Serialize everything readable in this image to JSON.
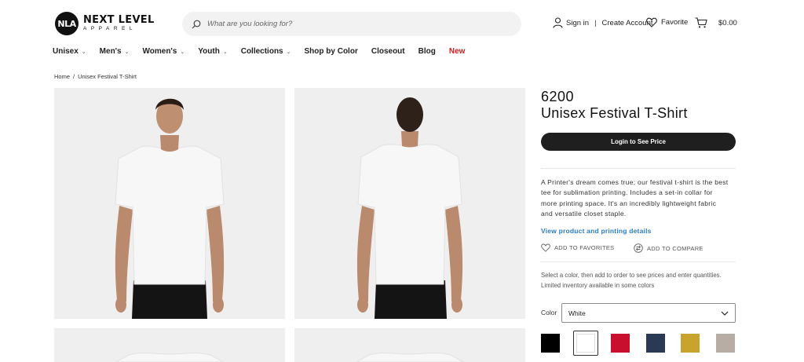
{
  "header": {
    "logo_badge": "NLA",
    "logo_main": "NEXT LEVEL",
    "logo_sub": "APPAREL",
    "search_placeholder": "What are you looking for?",
    "sign_in": "Sign in",
    "create_account": "Create Account",
    "favorite": "Favorite",
    "cart_total": "$0.00"
  },
  "nav": [
    {
      "label": "Unisex",
      "dropdown": true
    },
    {
      "label": "Men's",
      "dropdown": true
    },
    {
      "label": "Women's",
      "dropdown": true
    },
    {
      "label": "Youth",
      "dropdown": true
    },
    {
      "label": "Collections",
      "dropdown": true
    },
    {
      "label": "Shop by Color",
      "dropdown": false
    },
    {
      "label": "Closeout",
      "dropdown": false
    },
    {
      "label": "Blog",
      "dropdown": false
    },
    {
      "label": "New",
      "dropdown": false,
      "color": "#d71920"
    }
  ],
  "breadcrumb": {
    "home": "Home",
    "separator": "/",
    "current": "Unisex Festival T-Shirt"
  },
  "product": {
    "sku": "6200",
    "title": "Unisex Festival T-Shirt",
    "login_button": "Login to See Price",
    "description": "A Printer's dream comes true; our festival t-shirt is the best tee for sublimation printing. Includes a set-in collar for more printing space. It's an incredibly lightweight fabric and versatile closet staple.",
    "details_link": "View product and printing details",
    "add_favorites": "ADD TO FAVORITES",
    "add_compare": "ADD TO COMPARE",
    "note": "Select a color, then add to order to see prices and enter quantities. Limited inventory available in some colors",
    "color_label": "Color",
    "color_selected": "White",
    "swatches": [
      {
        "name": "black",
        "hex": "#000000"
      },
      {
        "name": "white",
        "hex": "#ffffff",
        "selected": true
      },
      {
        "name": "red",
        "hex": "#c8102e"
      },
      {
        "name": "navy",
        "hex": "#2a3a55"
      },
      {
        "name": "gold",
        "hex": "#c9a42c"
      },
      {
        "name": "heather",
        "hex": "#b8ada4"
      }
    ]
  },
  "colors": {
    "accent_link": "#2a7dc4",
    "button_dark": "#1f1f1f",
    "new_red": "#d71920"
  }
}
